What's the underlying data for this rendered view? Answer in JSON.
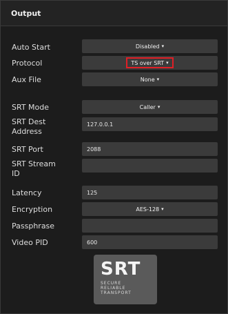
{
  "header": {
    "title": "Output"
  },
  "fields": {
    "auto_start": {
      "label": "Auto Start",
      "value": "Disabled"
    },
    "protocol": {
      "label": "Protocol",
      "value": "TS over SRT"
    },
    "aux_file": {
      "label": "Aux File",
      "value": "None"
    },
    "srt_mode": {
      "label": "SRT Mode",
      "value": "Caller"
    },
    "srt_dest_address": {
      "label_line1": "SRT Dest",
      "label_line2": "Address",
      "value": "127.0.0.1"
    },
    "srt_port": {
      "label": "SRT Port",
      "value": "2088"
    },
    "srt_stream_id": {
      "label_line1": "SRT Stream",
      "label_line2": "ID",
      "value": ""
    },
    "latency": {
      "label": "Latency",
      "value": "125"
    },
    "encryption": {
      "label": "Encryption",
      "value": "AES-128"
    },
    "passphrase": {
      "label": "Passphrase",
      "value": ""
    },
    "video_pid": {
      "label": "Video PID",
      "value": "600"
    }
  },
  "logo": {
    "big": "SRT",
    "line1": "SECURE",
    "line2": "RELIABLE",
    "line3": "TRANSPORT"
  },
  "colors": {
    "highlight": "#e01f26",
    "control_bg": "#3b3b3b",
    "panel_bg": "#1c1c1c"
  }
}
